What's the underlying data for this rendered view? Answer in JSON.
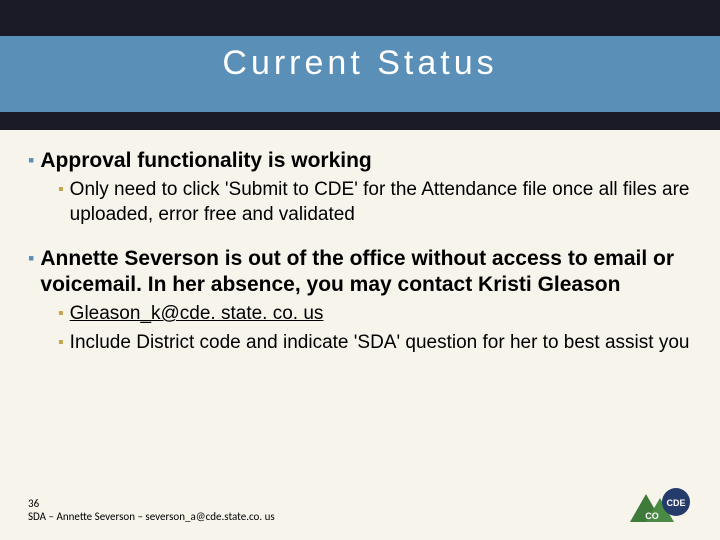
{
  "title": "Current Status",
  "bullets": {
    "b1": {
      "head": "Approval functionality is working",
      "sub1": "Only need to click 'Submit to CDE' for the Attendance file once all files are uploaded, error free and validated"
    },
    "b2": {
      "head": "Annette Severson is out of the office without access to email or voicemail.  In her absence, you may contact Kristi Gleason",
      "sub1": "Gleason_k@cde. state. co. us",
      "sub2": "Include District code and indicate 'SDA' question for her to best assist you"
    }
  },
  "footer": {
    "page": "36",
    "line": "SDA – Annette Severson – severson_a@cde.state.co. us"
  }
}
